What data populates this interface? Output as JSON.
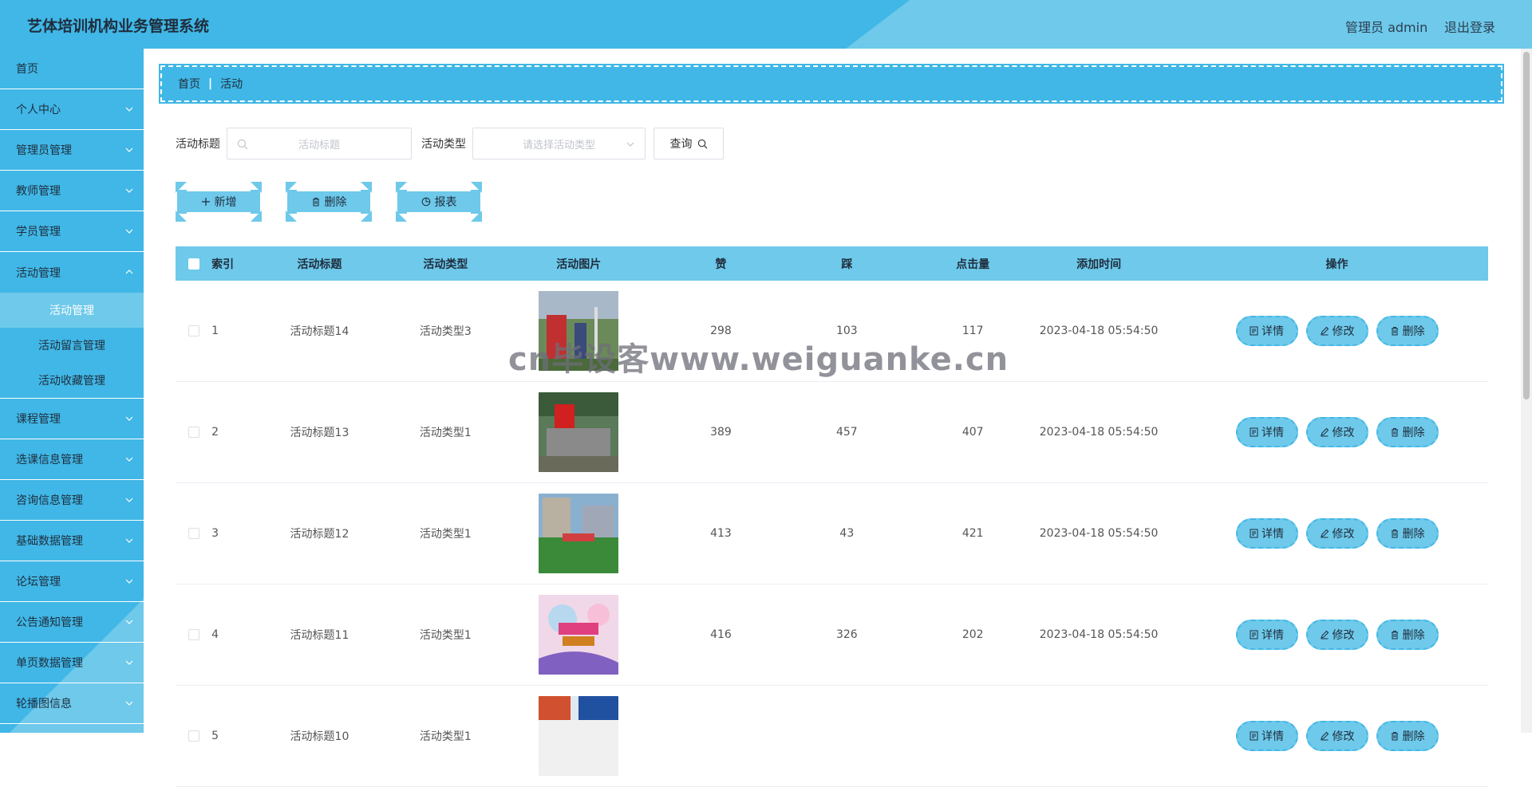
{
  "app": {
    "title": "艺体培训机构业务管理系统",
    "user": "管理员 admin",
    "logout": "退出登录"
  },
  "sidebar": {
    "home": "首页",
    "items": [
      {
        "label": "个人中心"
      },
      {
        "label": "管理员管理"
      },
      {
        "label": "教师管理"
      },
      {
        "label": "学员管理"
      },
      {
        "label": "活动管理"
      }
    ],
    "sub": [
      {
        "label": "活动管理"
      },
      {
        "label": "活动留言管理"
      },
      {
        "label": "活动收藏管理"
      }
    ],
    "items2": [
      {
        "label": "课程管理"
      },
      {
        "label": "选课信息管理"
      },
      {
        "label": "咨询信息管理"
      },
      {
        "label": "基础数据管理"
      },
      {
        "label": "论坛管理"
      },
      {
        "label": "公告通知管理"
      },
      {
        "label": "单页数据管理"
      },
      {
        "label": "轮播图信息"
      }
    ]
  },
  "breadcrumb": {
    "home": "首页",
    "current": "活动"
  },
  "search": {
    "title_label": "活动标题",
    "title_placeholder": "活动标题",
    "type_label": "活动类型",
    "type_placeholder": "请选择活动类型",
    "query": "查询"
  },
  "actions": {
    "add": "新增",
    "delete": "删除",
    "report": "报表"
  },
  "table": {
    "headers": {
      "index": "索引",
      "title": "活动标题",
      "type": "活动类型",
      "image": "活动图片",
      "like": "赞",
      "dislike": "踩",
      "clicks": "点击量",
      "time": "添加时间",
      "ops": "操作"
    },
    "ops": {
      "detail": "详情",
      "edit": "修改",
      "delete": "删除"
    },
    "rows": [
      {
        "index": "1",
        "title": "活动标题14",
        "type": "活动类型3",
        "like": "298",
        "dislike": "103",
        "clicks": "117",
        "time": "2023-04-18 05:54:50"
      },
      {
        "index": "2",
        "title": "活动标题13",
        "type": "活动类型1",
        "like": "389",
        "dislike": "457",
        "clicks": "407",
        "time": "2023-04-18 05:54:50"
      },
      {
        "index": "3",
        "title": "活动标题12",
        "type": "活动类型1",
        "like": "413",
        "dislike": "43",
        "clicks": "421",
        "time": "2023-04-18 05:54:50"
      },
      {
        "index": "4",
        "title": "活动标题11",
        "type": "活动类型1",
        "like": "416",
        "dislike": "326",
        "clicks": "202",
        "time": "2023-04-18 05:54:50"
      },
      {
        "index": "5",
        "title": "活动标题10",
        "type": "活动类型1",
        "like": "",
        "dislike": "",
        "clicks": "",
        "time": ""
      }
    ]
  },
  "watermark": "cn毕设客www.weiguanke.cn",
  "colors": {
    "primary": "#40b7e6",
    "accent": "#6ec9ea"
  }
}
